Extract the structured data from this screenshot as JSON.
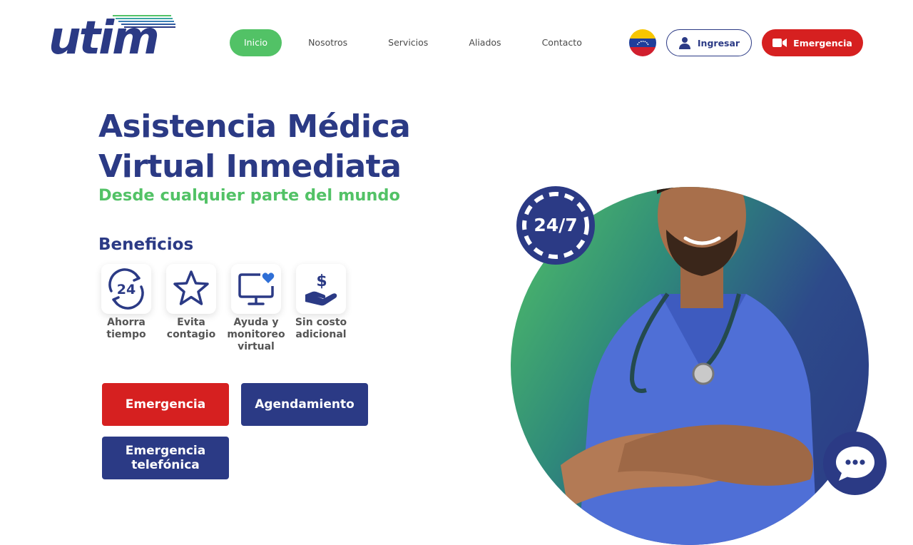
{
  "brand": {
    "logo_text": "utim"
  },
  "nav": {
    "items": [
      {
        "label": "Inicio",
        "active": true
      },
      {
        "label": "Nosotros",
        "active": false
      },
      {
        "label": "Servicios",
        "active": false
      },
      {
        "label": "Aliados",
        "active": false
      },
      {
        "label": "Contacto",
        "active": false
      }
    ]
  },
  "header": {
    "flag_icon": "venezuela-flag-icon",
    "login_label": "Ingresar",
    "emergency_label": "Emergencia"
  },
  "hero": {
    "title_line1": "Asistencia Médica",
    "title_line2": "Virtual Inmediata",
    "subtitle": "Desde cualquier parte del mundo",
    "badge": "24/7",
    "image_name": "doctor-photo"
  },
  "benefits": {
    "title": "Beneficios",
    "items": [
      {
        "icon": "clock-24-icon",
        "label_line1": "Ahorra",
        "label_line2": "tiempo",
        "label_line3": ""
      },
      {
        "icon": "star-icon",
        "label_line1": "Evita",
        "label_line2": "contagio",
        "label_line3": ""
      },
      {
        "icon": "monitor-heart-icon",
        "label_line1": "Ayuda y",
        "label_line2": "monitoreo",
        "label_line3": "virtual"
      },
      {
        "icon": "hand-dollar-icon",
        "label_line1": "Sin costo",
        "label_line2": "adicional",
        "label_line3": ""
      }
    ]
  },
  "actions": {
    "emergency": "Emergencia",
    "scheduling": "Agendamiento",
    "phone_line1": "Emergencia",
    "phone_line2": "telefónica"
  },
  "colors": {
    "primary": "#2b3a85",
    "accent_green": "#52c266",
    "danger": "#d62020"
  }
}
